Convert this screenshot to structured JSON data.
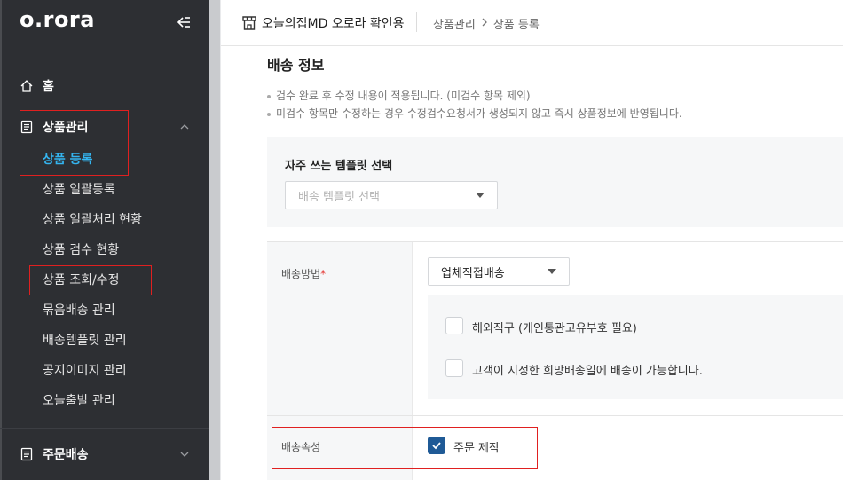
{
  "sidebar": {
    "logo": "o.rora",
    "items": [
      {
        "label": "홈"
      },
      {
        "label": "상품관리"
      },
      {
        "label": "상품 등록"
      },
      {
        "label": "상품 일괄등록"
      },
      {
        "label": "상품 일괄처리 현황"
      },
      {
        "label": "상품 검수 현황"
      },
      {
        "label": "상품 조회/수정"
      },
      {
        "label": "묶음배송 관리"
      },
      {
        "label": "배송템플릿 관리"
      },
      {
        "label": "공지이미지 관리"
      },
      {
        "label": "오늘출발 관리"
      },
      {
        "label": "주문배송"
      }
    ],
    "active_color": "#34b5f0",
    "bg_color": "#2d2f33"
  },
  "header": {
    "store_name": "오늘의집MD 오로라 확인용",
    "breadcrumb": [
      "상품관리",
      "상품 등록"
    ]
  },
  "content": {
    "section_title": "배송 정보",
    "notes": [
      "검수 완료 후 수정 내용이 적용됩니다. (미검수 항목 제외)",
      "미검수 항목만 수정하는 경우 수정검수요청서가 생성되지 않고 즉시 상품정보에 반영됩니다."
    ],
    "template": {
      "label": "자주 쓰는 템플릿 선택",
      "placeholder": "배송 템플릿 선택"
    },
    "shipping_method": {
      "label": "배송방법",
      "required_mark": "*",
      "selected": "업체직접배송",
      "options": [
        {
          "label": "해외직구 (개인통관고유부호 필요)",
          "checked": false
        },
        {
          "label": "고객이 지정한 희망배송일에 배송이 가능합니다.",
          "checked": false
        }
      ]
    },
    "shipping_attr": {
      "label": "배송속성",
      "option": {
        "label": "주문 제작",
        "checked": true
      }
    }
  },
  "annotation_color": "#e02020"
}
